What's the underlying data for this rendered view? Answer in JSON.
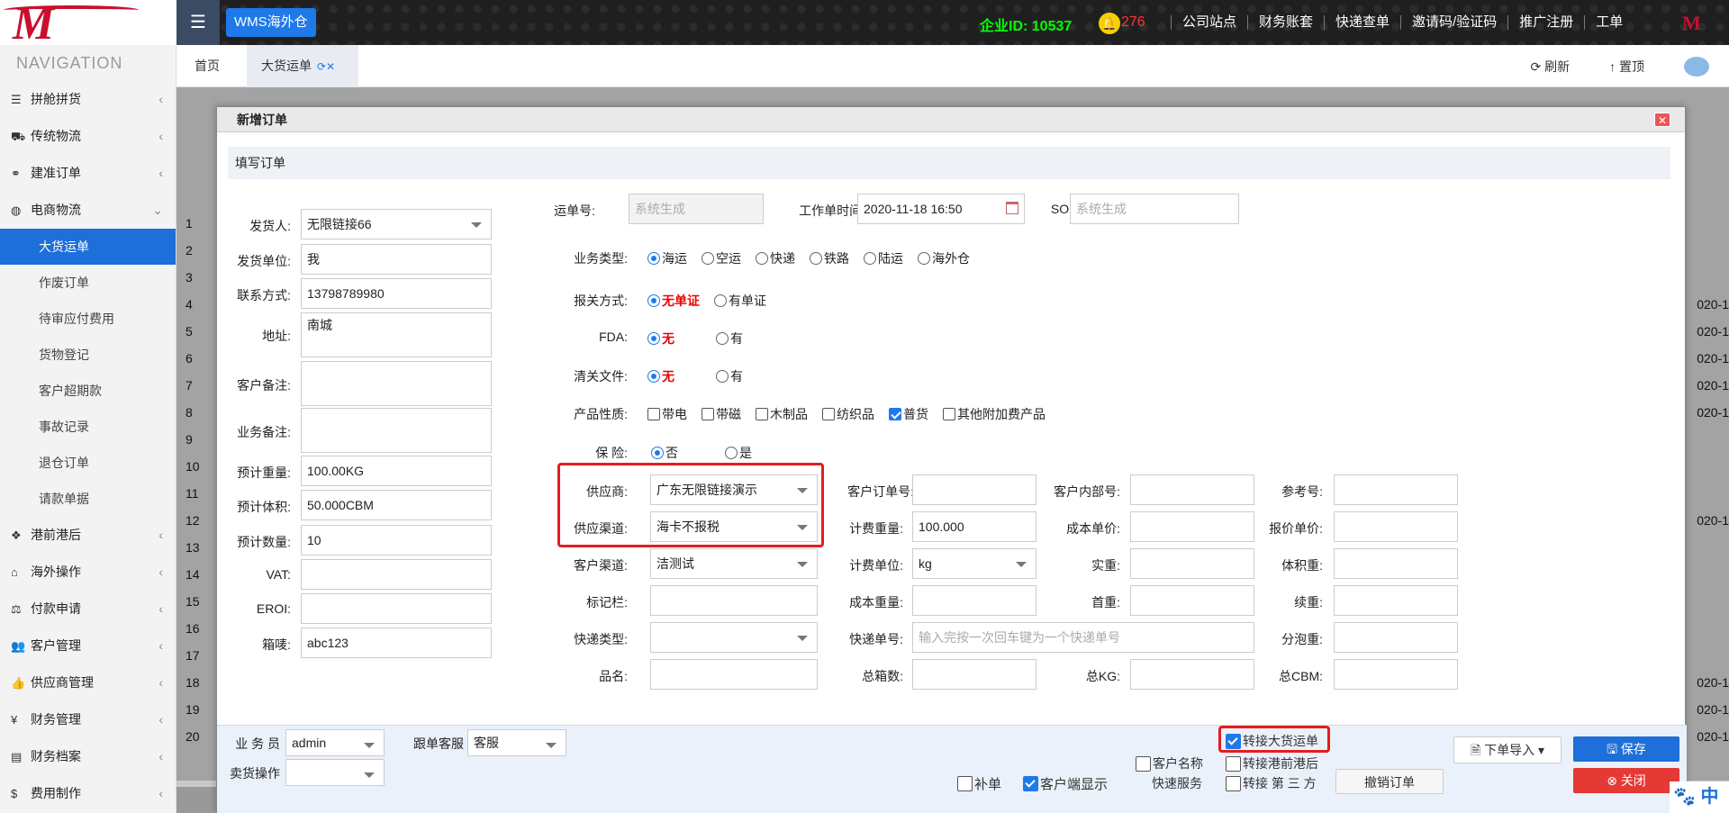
{
  "app": {
    "logo_text": "M",
    "menu_icon": "hamburger-icon",
    "app_button": "WMS海外仓",
    "company_id": "企业ID: 10537",
    "bell_count": "276",
    "top_links": [
      "公司站点",
      "财务账套",
      "快递查单",
      "邀请码/验证码",
      "推广注册",
      "工单"
    ]
  },
  "sidebar": {
    "title": "NAVIGATION",
    "groups_top": [
      {
        "label": "拼舱拼货",
        "icon": "list-icon"
      },
      {
        "label": "传统物流",
        "icon": "truck-icon"
      },
      {
        "label": "建准订单",
        "icon": "link-icon"
      },
      {
        "label": "电商物流",
        "icon": "globe-icon"
      }
    ],
    "sub_items": [
      "大货运单",
      "作废订单",
      "待审应付费用",
      "货物登记",
      "客户超期款",
      "事故记录",
      "退仓订单",
      "请款单据"
    ],
    "groups_bottom": [
      {
        "label": "港前港后",
        "icon": "cubes-icon"
      },
      {
        "label": "海外操作",
        "icon": "bank-icon"
      },
      {
        "label": "付款申请",
        "icon": "scale-icon"
      },
      {
        "label": "客户管理",
        "icon": "users-icon"
      },
      {
        "label": "供应商管理",
        "icon": "thumb-icon"
      },
      {
        "label": "财务管理",
        "icon": "yen-icon"
      },
      {
        "label": "财务档案",
        "icon": "book-icon"
      },
      {
        "label": "费用制作",
        "icon": "dollar-icon"
      }
    ]
  },
  "tabs": {
    "home": "首页",
    "cargo": "大货运单",
    "refresh": "刷新",
    "top": "置顶"
  },
  "background": {
    "row_numbers": [
      "1",
      "2",
      "3",
      "4",
      "5",
      "6",
      "7",
      "8",
      "9",
      "10",
      "11",
      "12",
      "13",
      "14",
      "15",
      "16",
      "17",
      "18",
      "19",
      "20"
    ],
    "date_fragment": "020-1"
  },
  "modal": {
    "title": "新增订单",
    "section": "填写订单",
    "left": {
      "shipper_label": "发货人:",
      "shipper": "无限链接66",
      "unit_label": "发货单位:",
      "unit": "我",
      "contact_label": "联系方式:",
      "contact": "13798789980",
      "address_label": "地址:",
      "address": "南城",
      "cust_note_label": "客户备注:",
      "biz_note_label": "业务备注:",
      "weight_label": "预计重量:",
      "weight": "100.00KG",
      "volume_label": "预计体积:",
      "volume": "50.000CBM",
      "qty_label": "预计数量:",
      "qty": "10",
      "vat_label": "VAT:",
      "eori_label": "EROI:",
      "mark_label": "箱唛:",
      "mark": "abc123"
    },
    "waybill_label": "运单号:",
    "waybill_ph": "系统生成",
    "worktime_label": "工作单时间:",
    "worktime": "2020-11-18 16:50",
    "so_label": "SO:",
    "so_ph": "系统生成",
    "biztype_label": "业务类型:",
    "biztype_options": [
      {
        "label": "海运",
        "checked": true
      },
      {
        "label": "空运",
        "checked": false
      },
      {
        "label": "快递",
        "checked": false
      },
      {
        "label": "铁路",
        "checked": false
      },
      {
        "label": "陆运",
        "checked": false
      },
      {
        "label": "海外仓",
        "checked": false
      }
    ],
    "customs_label": "报关方式:",
    "customs_opt1": "无单证",
    "customs_opt2": "有单证",
    "fda_label": "FDA:",
    "fda_opt1": "无",
    "fda_opt2": "有",
    "clear_label": "清关文件:",
    "clear_opt1": "无",
    "clear_opt2": "有",
    "product_label": "产品性质:",
    "product_options": [
      {
        "label": "带电",
        "checked": false
      },
      {
        "label": "带磁",
        "checked": false
      },
      {
        "label": "木制品",
        "checked": false
      },
      {
        "label": "纺织品",
        "checked": false
      },
      {
        "label": "普货",
        "checked": true
      },
      {
        "label": "其他附加费产品",
        "checked": false
      }
    ],
    "insurance_label": "保    险:",
    "ins_opt1": "否",
    "ins_opt2": "是",
    "grid": {
      "supplier_label": "供应商:",
      "supplier": "广东无限链接演示",
      "cust_order_label": "客户订单号:",
      "cust_inner_label": "客户内部号:",
      "ref_label": "参考号:",
      "channel_label": "供应渠道:",
      "channel": "海卡不报税",
      "charge_weight_label": "计费重量:",
      "charge_weight": "100.000",
      "cost_price_label": "成本单价:",
      "quote_price_label": "报价单价:",
      "cust_channel_label": "客户渠道:",
      "cust_channel": "洁测试",
      "charge_unit_label": "计费单位:",
      "charge_unit": "kg",
      "actual_weight_label": "实重:",
      "vol_weight_label": "体积重:",
      "tag_label": "标记栏:",
      "cost_weight_label": "成本重量:",
      "first_weight_label": "首重:",
      "cont_weight_label": "续重:",
      "express_type_label": "快递类型:",
      "express_no_label": "快递单号:",
      "express_no_ph": "输入完按一次回车键为一个快递单号",
      "split_weight_label": "分泡重:",
      "product_name_label": "品名:",
      "total_boxes_label": "总箱数:",
      "total_kg_label": "总KG:",
      "total_cbm_label": "总CBM:"
    },
    "footer": {
      "salesman_label": "业 务 员",
      "salesman": "admin",
      "cs_label": "跟单客服",
      "cs": "客服",
      "seller_label": "卖货操作",
      "supplement": "补单",
      "client_display": "客户端显示",
      "cust_name": "客户名称",
      "express_service": "快速服务",
      "transfer_cargo": "转接大货运单",
      "transfer_pre": "转接港前港后",
      "transfer_third": "转接 第 三 方",
      "cancel_order": "撤销订单",
      "import": "下单导入",
      "save": "保存",
      "close": "关闭"
    }
  }
}
